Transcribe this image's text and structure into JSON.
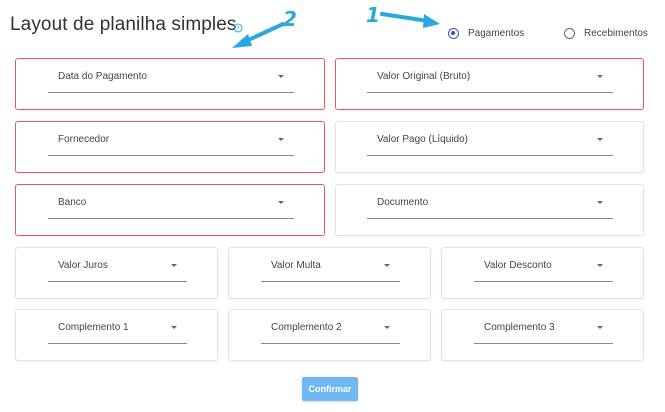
{
  "header": {
    "title": "Layout de planilha simples",
    "help_icon": "question-circle-icon"
  },
  "annotations": {
    "marker_1": "1",
    "marker_2": "2",
    "color": "#29a8e0"
  },
  "radio": {
    "options": [
      {
        "label": "Pagamentos",
        "checked": true
      },
      {
        "label": "Recebimentos",
        "checked": false
      }
    ]
  },
  "fields": {
    "data_pagamento": "Data do Pagamento",
    "valor_original": "Valor Original (Bruto)",
    "fornecedor": "Fornecedor",
    "valor_pago": "Valor Pago (Líquido)",
    "banco": "Banco",
    "documento": "Documento",
    "valor_juros": "Valor Juros",
    "valor_multa": "Valor Multa",
    "valor_desconto": "Valor Desconto",
    "complemento_1": "Complemento 1",
    "complemento_2": "Complemento 2",
    "complemento_3": "Complemento 3"
  },
  "actions": {
    "confirm_label": "Confirmar"
  },
  "colors": {
    "error_border": "#e05a64",
    "accent": "#3f51b5",
    "button": "#6fb8f2"
  }
}
